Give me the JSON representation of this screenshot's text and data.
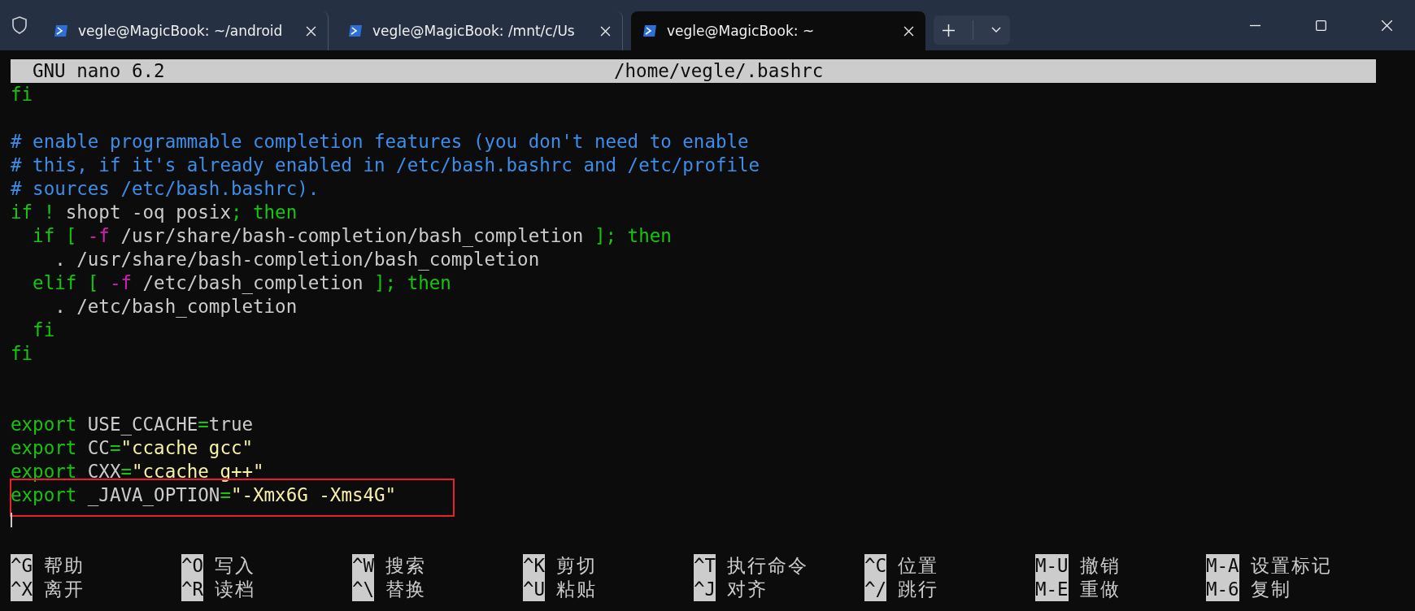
{
  "tabs": [
    {
      "label": "vegle@MagicBook: ~/android",
      "selected": false
    },
    {
      "label": "vegle@MagicBook: /mnt/c/Us",
      "selected": false
    },
    {
      "label": "vegle@MagicBook: ~",
      "selected": true
    }
  ],
  "editor": {
    "title": "GNU nano 6.2",
    "file": "/home/vegle/.bashrc"
  },
  "lines": [
    {
      "kind": "code",
      "segments": [
        {
          "text": "fi",
          "kind": "keyword"
        }
      ]
    },
    {
      "kind": "blank"
    },
    {
      "kind": "code",
      "segments": [
        {
          "text": "# enable programmable completion features (you don't need to enable",
          "kind": "comment"
        }
      ]
    },
    {
      "kind": "code",
      "segments": [
        {
          "text": "# this, if it's already enabled in /etc/bash.bashrc and /etc/profile",
          "kind": "comment"
        }
      ]
    },
    {
      "kind": "code",
      "segments": [
        {
          "text": "# sources /etc/bash.bashrc).",
          "kind": "comment"
        }
      ]
    },
    {
      "kind": "code",
      "segments": [
        {
          "text": "if !",
          "kind": "keyword"
        },
        {
          "text": " shopt -oq posix",
          "kind": "plain"
        },
        {
          "text": "; then",
          "kind": "keyword"
        }
      ]
    },
    {
      "kind": "code",
      "segments": [
        {
          "text": "  if [ ",
          "kind": "keyword"
        },
        {
          "text": "-f",
          "kind": "flag"
        },
        {
          "text": " /usr/share/bash-completion/bash_completion ",
          "kind": "plain"
        },
        {
          "text": "]; then",
          "kind": "keyword"
        }
      ]
    },
    {
      "kind": "code",
      "segments": [
        {
          "text": "    . /usr/share/bash-completion/bash_completion",
          "kind": "plain"
        }
      ]
    },
    {
      "kind": "code",
      "segments": [
        {
          "text": "  elif [ ",
          "kind": "keyword"
        },
        {
          "text": "-f",
          "kind": "flag"
        },
        {
          "text": " /etc/bash_completion ",
          "kind": "plain"
        },
        {
          "text": "]; then",
          "kind": "keyword"
        }
      ]
    },
    {
      "kind": "code",
      "segments": [
        {
          "text": "    . /etc/bash_completion",
          "kind": "plain"
        }
      ]
    },
    {
      "kind": "code",
      "segments": [
        {
          "text": "  fi",
          "kind": "keyword"
        }
      ]
    },
    {
      "kind": "code",
      "segments": [
        {
          "text": "fi",
          "kind": "keyword"
        }
      ]
    },
    {
      "kind": "blank"
    },
    {
      "kind": "blank"
    },
    {
      "kind": "code",
      "segments": [
        {
          "text": "export",
          "kind": "keyword"
        },
        {
          "text": " USE_CCACHE",
          "kind": "plain"
        },
        {
          "text": "=",
          "kind": "keyword"
        },
        {
          "text": "true",
          "kind": "plain"
        }
      ]
    },
    {
      "kind": "code",
      "segments": [
        {
          "text": "export",
          "kind": "keyword"
        },
        {
          "text": " CC",
          "kind": "plain"
        },
        {
          "text": "=",
          "kind": "keyword"
        },
        {
          "text": "\"ccache gcc\"",
          "kind": "string"
        }
      ]
    },
    {
      "kind": "code",
      "segments": [
        {
          "text": "export",
          "kind": "keyword"
        },
        {
          "text": " CXX",
          "kind": "plain"
        },
        {
          "text": "=",
          "kind": "keyword"
        },
        {
          "text": "\"ccache g++\"",
          "kind": "string"
        }
      ]
    },
    {
      "kind": "code",
      "highlighted": true,
      "segments": [
        {
          "text": "export",
          "kind": "keyword"
        },
        {
          "text": " _JAVA_OPTION",
          "kind": "plain"
        },
        {
          "text": "=",
          "kind": "keyword"
        },
        {
          "text": "\"-Xmx6G -Xms4G\"",
          "kind": "string"
        }
      ]
    },
    {
      "kind": "cursor"
    },
    {
      "kind": "blank"
    }
  ],
  "shortcuts": [
    [
      {
        "key": "^G",
        "label": "帮助"
      },
      {
        "key": "^O",
        "label": "写入"
      },
      {
        "key": "^W",
        "label": "搜索"
      },
      {
        "key": "^K",
        "label": "剪切"
      },
      {
        "key": "^T",
        "label": "执行命令"
      },
      {
        "key": "^C",
        "label": "位置"
      },
      {
        "key": "M-U",
        "label": "撤销"
      },
      {
        "key": "M-A",
        "label": "设置标记"
      }
    ],
    [
      {
        "key": "^X",
        "label": "离开"
      },
      {
        "key": "^R",
        "label": "读档"
      },
      {
        "key": "^\\",
        "label": "替换"
      },
      {
        "key": "^U",
        "label": "粘贴"
      },
      {
        "key": "^J",
        "label": "对齐"
      },
      {
        "key": "^/",
        "label": "跳行"
      },
      {
        "key": "M-E",
        "label": "重做"
      },
      {
        "key": "M-6",
        "label": "复制"
      }
    ]
  ]
}
